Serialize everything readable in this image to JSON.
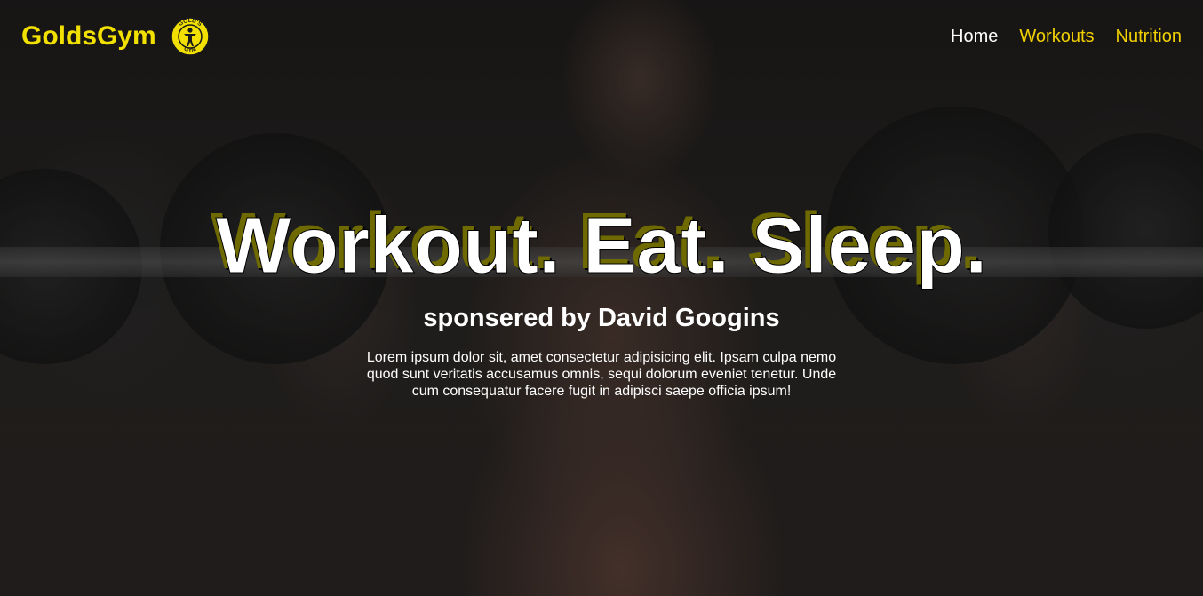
{
  "header": {
    "brand": "GoldsGym",
    "logo_text": "GOLD'S GYM",
    "nav": [
      {
        "label": "Home",
        "active": true
      },
      {
        "label": "Workouts",
        "active": false
      },
      {
        "label": "Nutrition",
        "active": false
      }
    ]
  },
  "hero": {
    "headline": "Workout. Eat. Sleep.",
    "subtitle": "sponsered by David Googins",
    "body": "Lorem ipsum dolor sit, amet consectetur adipisicing elit. Ipsam culpa nemo quod sunt veritatis accusamus omnis, sequi dolorum eveniet tenetur. Unde cum consequatur facere fugit in adipisci saepe officia ipsum!"
  },
  "colors": {
    "brand_yellow": "#f2e000",
    "link_yellow": "#f2d000",
    "active_link": "#ffffff",
    "headline_shadow": "#6e6a00"
  }
}
